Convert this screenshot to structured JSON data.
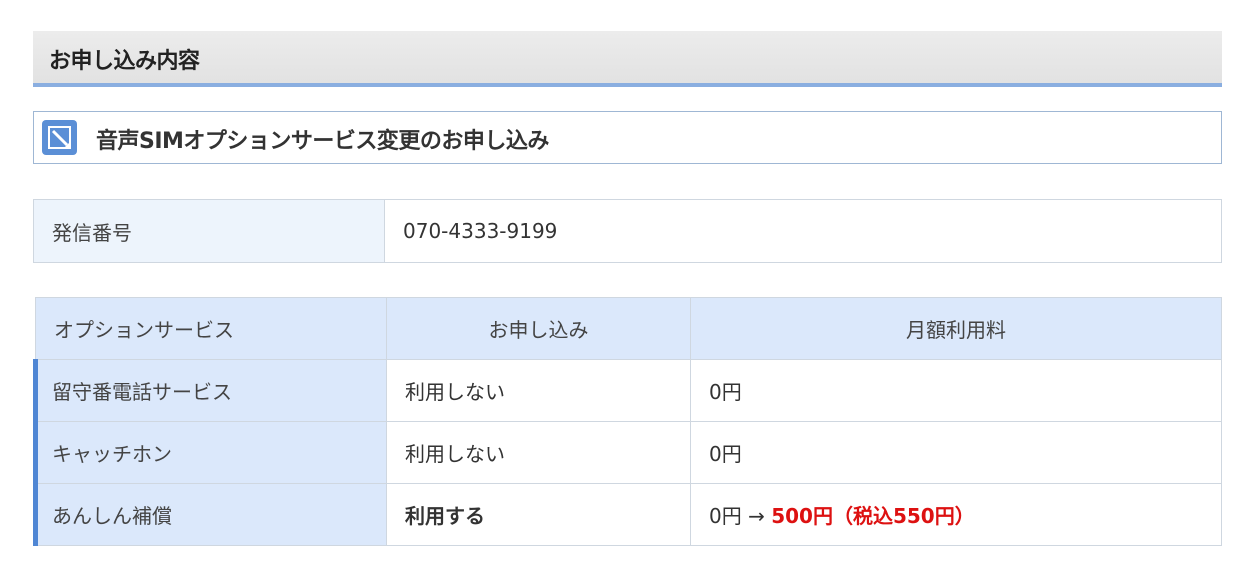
{
  "section": {
    "title": "お申し込み内容"
  },
  "subheader": {
    "icon": "edit-icon",
    "title": "音声SIMオプションサービス変更のお申し込み"
  },
  "number_table": {
    "label": "発信番号",
    "value": "070-4333-9199"
  },
  "options_table": {
    "headers": [
      "オプションサービス",
      "お申し込み",
      "月額利用料"
    ],
    "rows": [
      {
        "service": "留守番電話サービス",
        "application": "利用しない",
        "fee_old": "0円",
        "arrow": "",
        "fee_new": ""
      },
      {
        "service": "キャッチホン",
        "application": "利用しない",
        "fee_old": "0円",
        "arrow": "",
        "fee_new": ""
      },
      {
        "service": "あんしん補償",
        "application": "利用する",
        "fee_old": "0円",
        "arrow": "→",
        "fee_new": "500円（税込550円）"
      }
    ]
  },
  "colors": {
    "accent": "#4f86d4",
    "highlight": "#dd1111",
    "header_bg": "#dbe8fb"
  }
}
